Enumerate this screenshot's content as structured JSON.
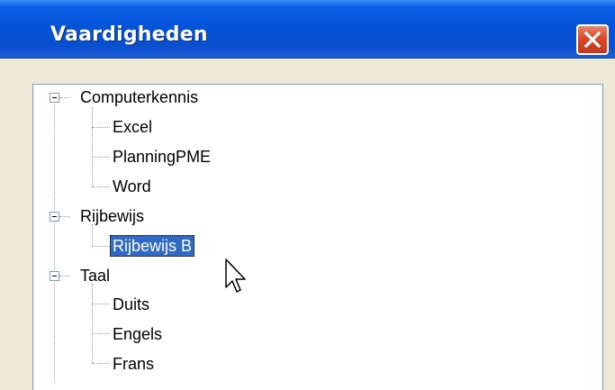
{
  "window": {
    "title": "Vaardigheden"
  },
  "tree": {
    "groups": [
      {
        "label": "Computerkennis",
        "children": [
          "Excel",
          "PlanningPME",
          "Word"
        ]
      },
      {
        "label": "Rijbewijs",
        "children": [
          "Rijbewijs B"
        ]
      },
      {
        "label": "Taal",
        "children": [
          "Duits",
          "Engels",
          "Frans"
        ]
      }
    ],
    "selected": "Rijbewijs B"
  },
  "colors": {
    "titlebar": "#0554d8",
    "selection": "#316ac5",
    "close": "#d8482a"
  }
}
